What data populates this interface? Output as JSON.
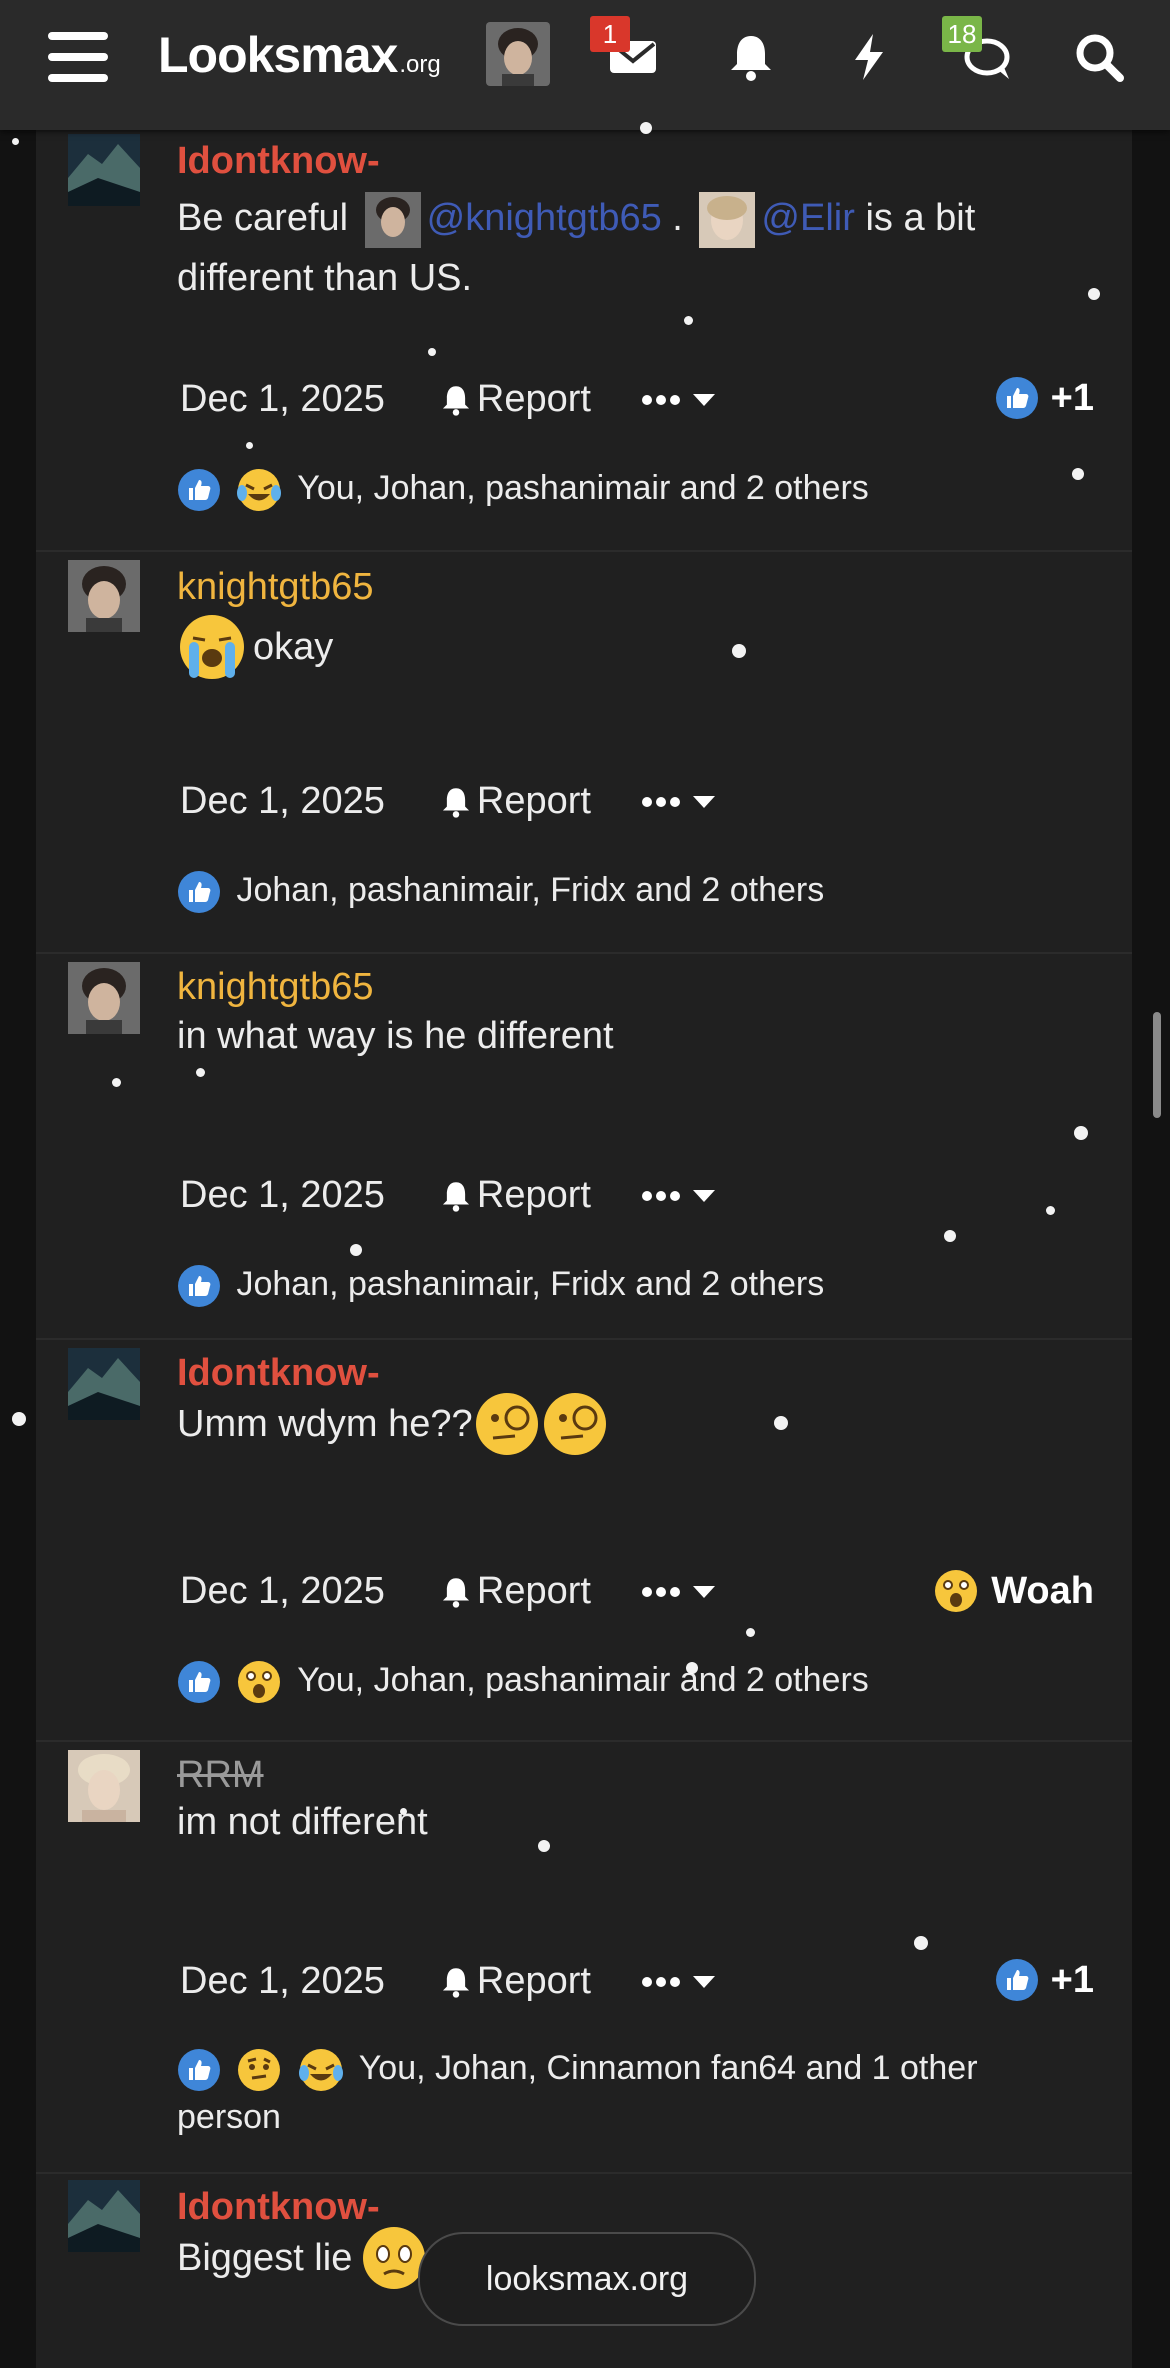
{
  "site": {
    "logo_main": "Looksmax",
    "logo_suffix": ".org",
    "inbox_badge": "1",
    "chat_badge": "18",
    "inbox_badge_color": "#d9372b",
    "chat_badge_color": "#7ab648"
  },
  "icons": [
    "menu-icon",
    "avatar",
    "mail-icon",
    "bell-icon",
    "bolt-icon",
    "chat-icon",
    "search-icon"
  ],
  "posts": [
    {
      "user": "Idontknow-",
      "text_before": "Be careful",
      "mention1": "@knightgtb65",
      "sep": ".",
      "mention2": "@Elir",
      "text_after": "is a bit different than US.",
      "date": "Dec 1, 2025",
      "report": "Report",
      "right_reaction": "+1",
      "reactions": "You, Johan, pashanimair and 2 others"
    },
    {
      "user": "knightgtb65",
      "text": "okay",
      "date": "Dec 1, 2025",
      "report": "Report",
      "reactions": "Johan, pashanimair, Fridx and 2 others"
    },
    {
      "user": "knightgtb65",
      "text": "in what way is he different",
      "date": "Dec 1, 2025",
      "report": "Report",
      "reactions": "Johan, pashanimair, Fridx and 2 others"
    },
    {
      "user": "Idontknow-",
      "text": "Umm wdym he??",
      "date": "Dec 1, 2025",
      "report": "Report",
      "right_reaction": "Woah",
      "reactions": "You, Johan, pashanimair and 2 others"
    },
    {
      "user": "RRM",
      "text": "im not different",
      "date": "Dec 1, 2025",
      "report": "Report",
      "right_reaction": "+1",
      "reactions": "You, Johan, Cinnamon fan64 and 1 other person"
    },
    {
      "user": "Idontknow-",
      "text": "Biggest lie"
    }
  ],
  "bottom_pill": "looksmax.org"
}
